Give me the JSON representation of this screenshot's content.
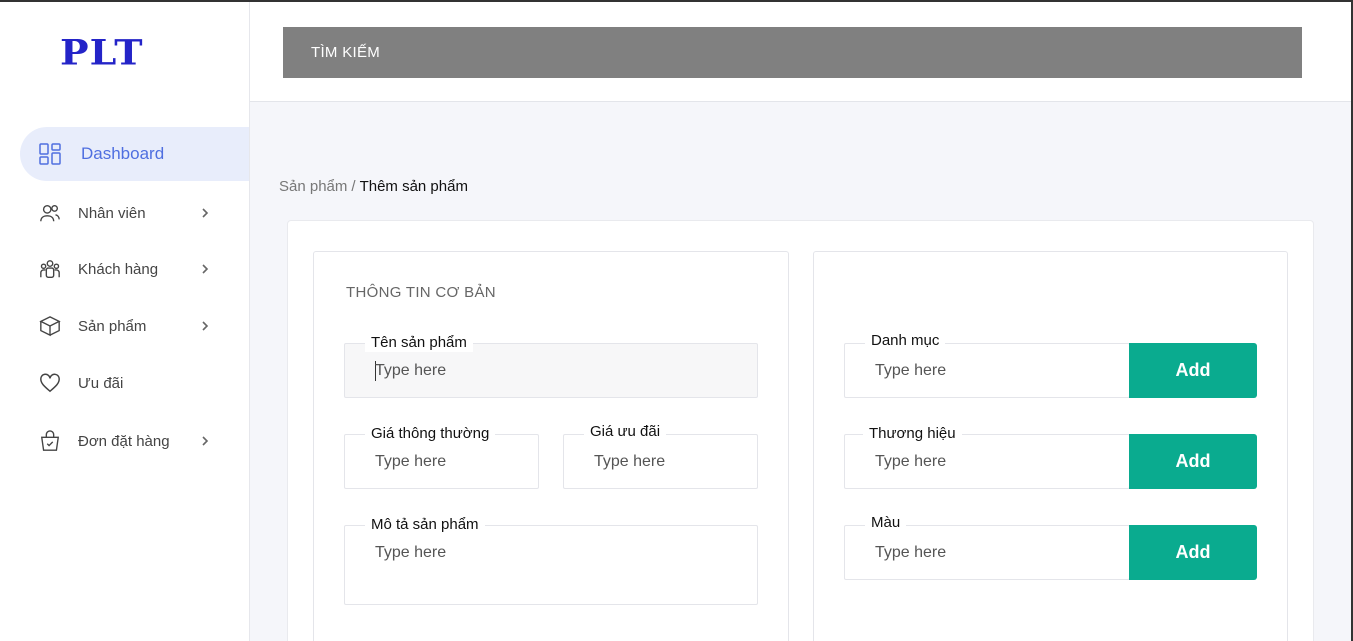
{
  "brand": {
    "logo": "PLT"
  },
  "sidebar": {
    "items": [
      {
        "label": "Dashboard",
        "icon": "grid-icon",
        "active": true
      },
      {
        "label": "Nhân viên",
        "icon": "users-icon",
        "has_children": true
      },
      {
        "label": "Khách hàng",
        "icon": "customers-icon",
        "has_children": true
      },
      {
        "label": "Sản phẩm",
        "icon": "box-icon",
        "has_children": true
      },
      {
        "label": "Ưu đãi",
        "icon": "heart-icon",
        "has_children": false
      },
      {
        "label": "Đơn đặt hàng",
        "icon": "basket-icon",
        "has_children": true
      }
    ]
  },
  "header": {
    "search_label": "TÌM KIẾM"
  },
  "breadcrumb": {
    "parent": "Sản phẩm",
    "separator": "/",
    "current": "Thêm sản phẩm"
  },
  "form": {
    "section_title": "THÔNG TIN CƠ BẢN",
    "product_name": {
      "label": "Tên sản phẩm",
      "placeholder": "Type here"
    },
    "regular_price": {
      "label": "Giá thông thường",
      "placeholder": "Type here"
    },
    "sale_price": {
      "label": "Giá ưu đãi",
      "placeholder": "Type here"
    },
    "description": {
      "label": "Mô tả sản phẩm",
      "placeholder": "Type here"
    },
    "category": {
      "label": "Danh mục",
      "placeholder": "Type here",
      "button": "Add"
    },
    "brand": {
      "label": "Thương hiệu",
      "placeholder": "Type here",
      "button": "Add"
    },
    "color": {
      "label": "Màu",
      "placeholder": "Type here",
      "button": "Add"
    }
  },
  "colors": {
    "accent": "#0aab8f",
    "active_nav": "#4f6fe0",
    "search_bg": "#808080",
    "logo": "#2424c8"
  }
}
